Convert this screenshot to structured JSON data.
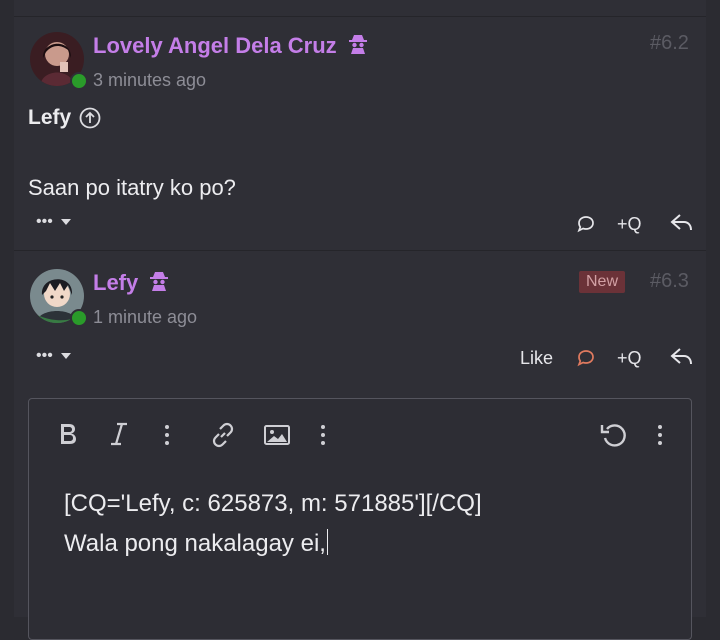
{
  "posts": [
    {
      "username": "Lovely Angel Dela Cruz",
      "time": "3 minutes ago",
      "number": "#6.2",
      "quote_name": "Lefy",
      "message": "Saan po itatry ko po?",
      "actions": {
        "more": "•••"
      }
    },
    {
      "username": "Lefy",
      "time": "1 minute ago",
      "number": "#6.3",
      "badge": "New",
      "actions": {
        "more": "•••",
        "like": "Like"
      }
    }
  ],
  "quote_action": "+Q",
  "editor": {
    "line1": "[CQ='Lefy, c: 625873, m: 571885'][/CQ]",
    "line2": "Wala pong nakalagay ei,"
  },
  "colors": {
    "accent_username": "#c47ee8",
    "online": "#2a9b2a",
    "new_badge_bg": "#6b3238",
    "active_comment": "#e07a5f"
  },
  "icons": [
    "spy-icon",
    "arrow-up-circle-icon",
    "comment-icon",
    "reply-icon",
    "bold-icon",
    "italic-icon",
    "link-icon",
    "image-icon",
    "undo-icon",
    "more-vertical-icon",
    "chevron-down-icon"
  ]
}
